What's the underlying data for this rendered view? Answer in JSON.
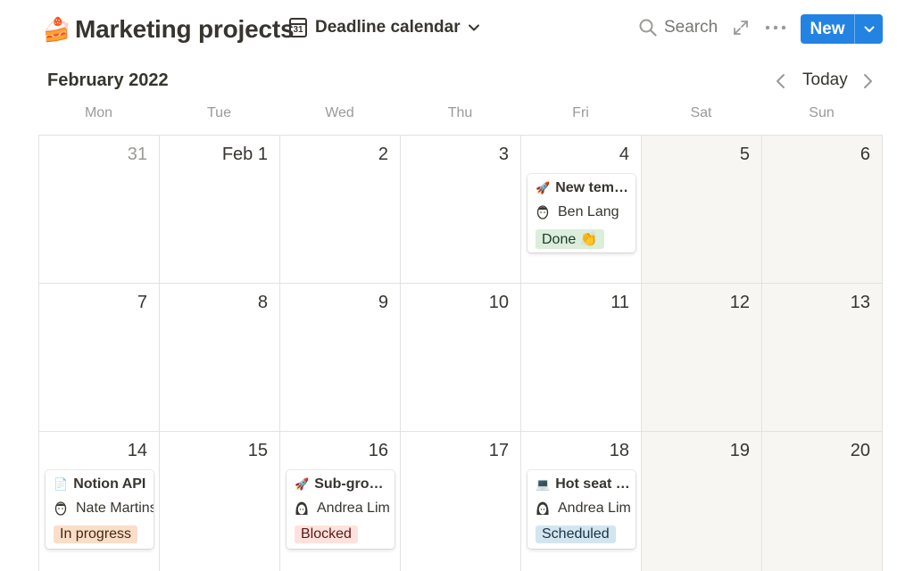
{
  "header": {
    "page_icon": "🍰",
    "title": "Marketing projects",
    "view_icon_text": "31",
    "view_name": "Deadline calendar",
    "search_label": "Search",
    "new_label": "New"
  },
  "calendar": {
    "month_label": "February 2022",
    "today_label": "Today",
    "weekdays": [
      "Mon",
      "Tue",
      "Wed",
      "Thu",
      "Fri",
      "Sat",
      "Sun"
    ],
    "weeks": [
      [
        "31",
        "Feb 1",
        "2",
        "3",
        "4",
        "5",
        "6"
      ],
      [
        "7",
        "8",
        "9",
        "10",
        "11",
        "12",
        "13"
      ],
      [
        "14",
        "15",
        "16",
        "17",
        "18",
        "19",
        "20"
      ]
    ],
    "events": [
      {
        "icon": "🚀",
        "title": "New templates",
        "person": "Ben Lang",
        "status": "Done 👏",
        "status_bg": "#dbeddb",
        "status_fg": "#1c3829"
      },
      {
        "icon": "📄",
        "title": "Notion API",
        "person": "Nate Martins",
        "status": "In progress",
        "status_bg": "#fadec9",
        "status_fg": "#49290e"
      },
      {
        "icon": "🚀",
        "title": "Sub-group launch",
        "person": "Andrea Lim",
        "status": "Blocked",
        "status_bg": "#ffe2dd",
        "status_fg": "#5d1715"
      },
      {
        "icon": "💻",
        "title": "Hot seat session",
        "person": "Andrea Lim",
        "status": "Scheduled",
        "status_bg": "#d3e5ef",
        "status_fg": "#183347"
      }
    ]
  },
  "colors": {
    "accent": "#2383e2",
    "text": "#37352f",
    "muted": "#9b9a97",
    "weekend_bg": "#f7f6f3",
    "grid_line": "#e3e2e0"
  }
}
